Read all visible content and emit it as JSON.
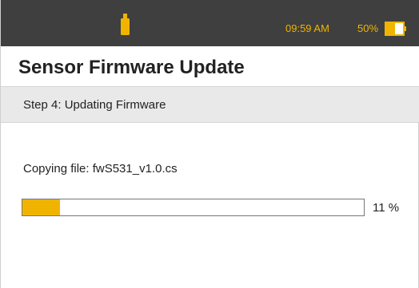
{
  "status_bar": {
    "icon": "usb-stick-icon",
    "time": "09:59 AM",
    "battery_percent": "50%",
    "battery_icon": "battery-icon",
    "accent_color": "#f0b400",
    "background_color": "#3f3f3f"
  },
  "header": {
    "title": "Sensor Firmware Update"
  },
  "step": {
    "label": "Step 4: Updating Firmware"
  },
  "main": {
    "copying_label": "Copying file: fwS531_v1.0.cs",
    "progress_value": 11,
    "progress_text": "11 %"
  }
}
